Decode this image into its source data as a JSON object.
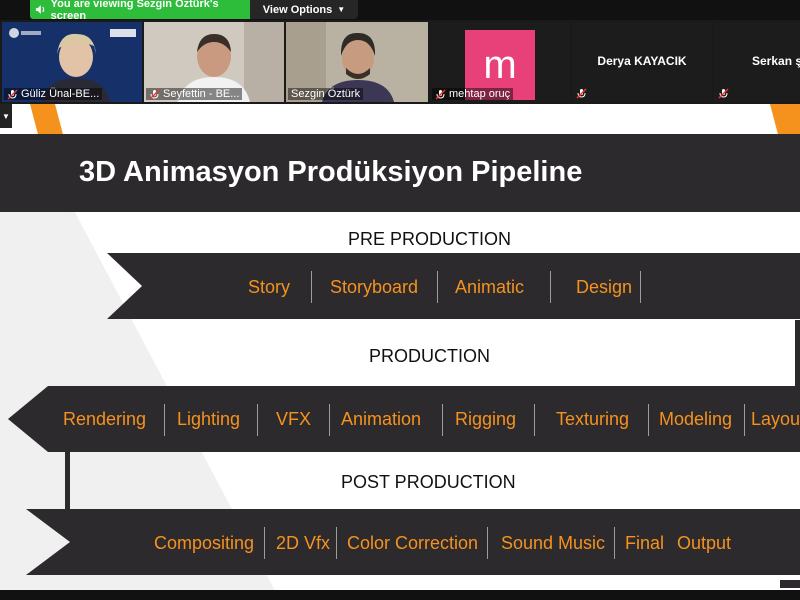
{
  "share_banner": {
    "viewing_text": "You are viewing Sezgin Öztürk's screen",
    "view_options_label": "View Options"
  },
  "participants": [
    {
      "name": "Güliz Ünal-BE..."
    },
    {
      "name": "Seyfettin - BE..."
    },
    {
      "name": "Sezgin Öztürk"
    },
    {
      "name": "mehtap oruç",
      "avatar_letter": "m"
    },
    {
      "name": "Derya KAYACIK"
    },
    {
      "name": "Serkan ş"
    }
  ],
  "slide": {
    "title": "3D Animasyon Prodüksiyon Pipeline",
    "pre_production": {
      "label": "PRE PRODUCTION",
      "items": [
        "Story",
        "Storyboard",
        "Animatic",
        "Design"
      ]
    },
    "production": {
      "label": "PRODUCTION",
      "items": [
        "Rendering",
        "Lighting",
        "VFX",
        "Animation",
        "Rigging",
        "Texturing",
        "Modeling",
        "Layou"
      ]
    },
    "post_production": {
      "label": "POST PRODUCTION",
      "items": [
        "Compositing",
        "2D Vfx",
        "Color Correction",
        "Sound Music",
        "Final",
        "Output"
      ]
    }
  },
  "colors": {
    "accent_orange": "#f5921e",
    "band_dark": "#2d2a2e",
    "share_green": "#2dbd3a",
    "avatar_pink": "#e8417a"
  }
}
